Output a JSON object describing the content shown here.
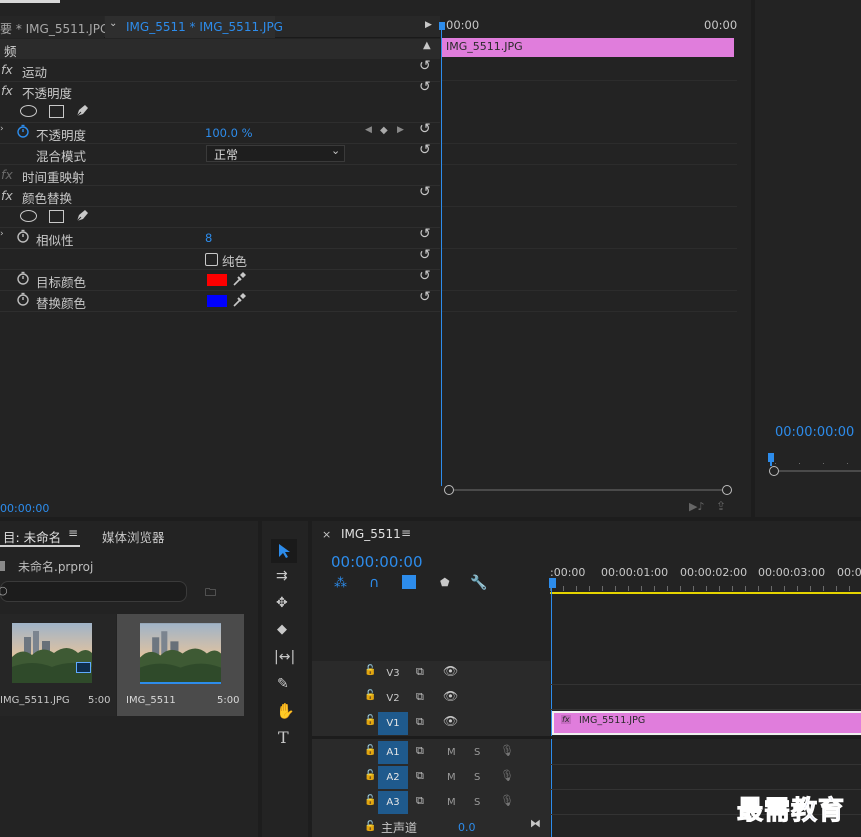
{
  "effect_controls": {
    "tab_master": "要 * IMG_5511.JPG",
    "tab_clip": "IMG_5511 * IMG_5511.JPG",
    "section_title": "频",
    "fx_symbol": "fx",
    "effects": {
      "motion": "运动",
      "opacity_group": "不透明度",
      "opacity_param": "不透明度",
      "opacity_value": "100.0 %",
      "blend_mode_label": "混合模式",
      "blend_mode_value": "正常",
      "time_remap": "时间重映射",
      "color_replace": "颜色替换",
      "similarity_label": "相似性",
      "similarity_value": "8",
      "solid_color_label": "纯色",
      "target_color_label": "目标颜色",
      "target_color": "#ff0000",
      "replace_color_label": "替换颜色",
      "replace_color": "#0000ff"
    },
    "mini_timeline": {
      "tick_start": "00:00",
      "tick_end": "00:00",
      "clip_name": "IMG_5511.JPG",
      "clip_color": "#e07ddc"
    },
    "timecode": "00:00:00"
  },
  "program_monitor": {
    "timecode": "00:00:00:00"
  },
  "project_panel": {
    "tab_project": "目: 未命名",
    "tab_media_browser": "媒体浏览器",
    "project_file": "未命名.prproj",
    "items": [
      {
        "name": "IMG_5511.JPG",
        "duration": "5:00"
      },
      {
        "name": "IMG_5511",
        "duration": "5:00"
      }
    ]
  },
  "tools": [
    "selection-tool",
    "track-select-tool",
    "ripple-edit-tool",
    "razor-tool",
    "slip-tool",
    "pen-tool",
    "hand-tool",
    "type-tool"
  ],
  "timeline": {
    "close_symbol": "×",
    "sequence_name": "IMG_5511",
    "timecode": "00:00:00:00",
    "ruler": [
      ":00:00",
      "00:00:01:00",
      "00:00:02:00",
      "00:00:03:00",
      "00:0"
    ],
    "tracks": {
      "v3": "V3",
      "v2": "V2",
      "v1": "V1",
      "a1": "A1",
      "a2": "A2",
      "a3": "A3",
      "mute": "M",
      "solo": "S",
      "master_label": "主声道",
      "master_value": "0.0"
    },
    "clip_name": "IMG_5511.JPG",
    "clip_fx": "fx"
  },
  "watermark": "最需教育",
  "colors": {
    "accent_blue": "#2d8ceb",
    "clip_pink": "#e07ddc",
    "track_blue": "#1f5a8d",
    "playhead_yellow": "#e5d400"
  }
}
